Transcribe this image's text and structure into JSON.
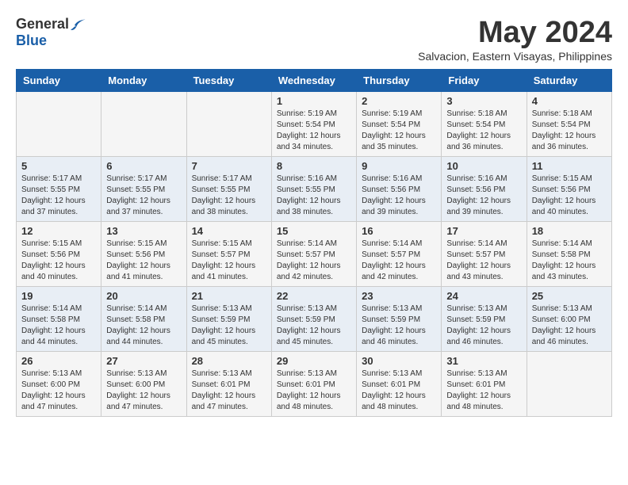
{
  "header": {
    "logo_general": "General",
    "logo_blue": "Blue",
    "month_title": "May 2024",
    "location": "Salvacion, Eastern Visayas, Philippines"
  },
  "calendar": {
    "days_of_week": [
      "Sunday",
      "Monday",
      "Tuesday",
      "Wednesday",
      "Thursday",
      "Friday",
      "Saturday"
    ],
    "weeks": [
      [
        {
          "day": "",
          "info": ""
        },
        {
          "day": "",
          "info": ""
        },
        {
          "day": "",
          "info": ""
        },
        {
          "day": "1",
          "info": "Sunrise: 5:19 AM\nSunset: 5:54 PM\nDaylight: 12 hours\nand 34 minutes."
        },
        {
          "day": "2",
          "info": "Sunrise: 5:19 AM\nSunset: 5:54 PM\nDaylight: 12 hours\nand 35 minutes."
        },
        {
          "day": "3",
          "info": "Sunrise: 5:18 AM\nSunset: 5:54 PM\nDaylight: 12 hours\nand 36 minutes."
        },
        {
          "day": "4",
          "info": "Sunrise: 5:18 AM\nSunset: 5:54 PM\nDaylight: 12 hours\nand 36 minutes."
        }
      ],
      [
        {
          "day": "5",
          "info": "Sunrise: 5:17 AM\nSunset: 5:55 PM\nDaylight: 12 hours\nand 37 minutes."
        },
        {
          "day": "6",
          "info": "Sunrise: 5:17 AM\nSunset: 5:55 PM\nDaylight: 12 hours\nand 37 minutes."
        },
        {
          "day": "7",
          "info": "Sunrise: 5:17 AM\nSunset: 5:55 PM\nDaylight: 12 hours\nand 38 minutes."
        },
        {
          "day": "8",
          "info": "Sunrise: 5:16 AM\nSunset: 5:55 PM\nDaylight: 12 hours\nand 38 minutes."
        },
        {
          "day": "9",
          "info": "Sunrise: 5:16 AM\nSunset: 5:56 PM\nDaylight: 12 hours\nand 39 minutes."
        },
        {
          "day": "10",
          "info": "Sunrise: 5:16 AM\nSunset: 5:56 PM\nDaylight: 12 hours\nand 39 minutes."
        },
        {
          "day": "11",
          "info": "Sunrise: 5:15 AM\nSunset: 5:56 PM\nDaylight: 12 hours\nand 40 minutes."
        }
      ],
      [
        {
          "day": "12",
          "info": "Sunrise: 5:15 AM\nSunset: 5:56 PM\nDaylight: 12 hours\nand 40 minutes."
        },
        {
          "day": "13",
          "info": "Sunrise: 5:15 AM\nSunset: 5:56 PM\nDaylight: 12 hours\nand 41 minutes."
        },
        {
          "day": "14",
          "info": "Sunrise: 5:15 AM\nSunset: 5:57 PM\nDaylight: 12 hours\nand 41 minutes."
        },
        {
          "day": "15",
          "info": "Sunrise: 5:14 AM\nSunset: 5:57 PM\nDaylight: 12 hours\nand 42 minutes."
        },
        {
          "day": "16",
          "info": "Sunrise: 5:14 AM\nSunset: 5:57 PM\nDaylight: 12 hours\nand 42 minutes."
        },
        {
          "day": "17",
          "info": "Sunrise: 5:14 AM\nSunset: 5:57 PM\nDaylight: 12 hours\nand 43 minutes."
        },
        {
          "day": "18",
          "info": "Sunrise: 5:14 AM\nSunset: 5:58 PM\nDaylight: 12 hours\nand 43 minutes."
        }
      ],
      [
        {
          "day": "19",
          "info": "Sunrise: 5:14 AM\nSunset: 5:58 PM\nDaylight: 12 hours\nand 44 minutes."
        },
        {
          "day": "20",
          "info": "Sunrise: 5:14 AM\nSunset: 5:58 PM\nDaylight: 12 hours\nand 44 minutes."
        },
        {
          "day": "21",
          "info": "Sunrise: 5:13 AM\nSunset: 5:59 PM\nDaylight: 12 hours\nand 45 minutes."
        },
        {
          "day": "22",
          "info": "Sunrise: 5:13 AM\nSunset: 5:59 PM\nDaylight: 12 hours\nand 45 minutes."
        },
        {
          "day": "23",
          "info": "Sunrise: 5:13 AM\nSunset: 5:59 PM\nDaylight: 12 hours\nand 46 minutes."
        },
        {
          "day": "24",
          "info": "Sunrise: 5:13 AM\nSunset: 5:59 PM\nDaylight: 12 hours\nand 46 minutes."
        },
        {
          "day": "25",
          "info": "Sunrise: 5:13 AM\nSunset: 6:00 PM\nDaylight: 12 hours\nand 46 minutes."
        }
      ],
      [
        {
          "day": "26",
          "info": "Sunrise: 5:13 AM\nSunset: 6:00 PM\nDaylight: 12 hours\nand 47 minutes."
        },
        {
          "day": "27",
          "info": "Sunrise: 5:13 AM\nSunset: 6:00 PM\nDaylight: 12 hours\nand 47 minutes."
        },
        {
          "day": "28",
          "info": "Sunrise: 5:13 AM\nSunset: 6:01 PM\nDaylight: 12 hours\nand 47 minutes."
        },
        {
          "day": "29",
          "info": "Sunrise: 5:13 AM\nSunset: 6:01 PM\nDaylight: 12 hours\nand 48 minutes."
        },
        {
          "day": "30",
          "info": "Sunrise: 5:13 AM\nSunset: 6:01 PM\nDaylight: 12 hours\nand 48 minutes."
        },
        {
          "day": "31",
          "info": "Sunrise: 5:13 AM\nSunset: 6:01 PM\nDaylight: 12 hours\nand 48 minutes."
        },
        {
          "day": "",
          "info": ""
        }
      ]
    ]
  }
}
